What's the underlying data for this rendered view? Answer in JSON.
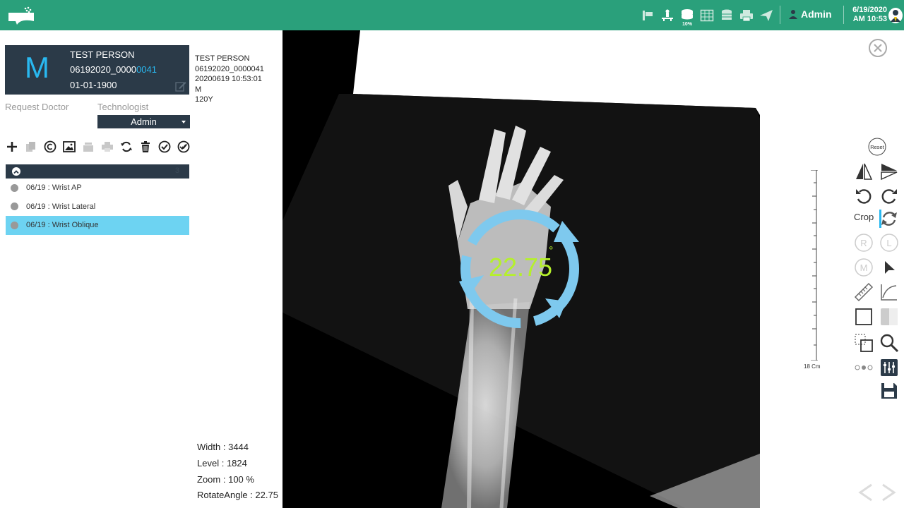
{
  "header": {
    "user": "Admin",
    "date": "6/19/2020",
    "time": "AM 10:53",
    "storage_pct": "10%"
  },
  "patient": {
    "initial": "M",
    "name": "TEST PERSON",
    "id_prefix": "06192020_0000",
    "id_suffix": "0041",
    "dob": "01-01-1900",
    "info_name": "TEST PERSON",
    "info_id": "06192020_0000041",
    "info_datetime": "20200619 10:53:01",
    "info_sex": "M",
    "info_age": "120Y"
  },
  "labels": {
    "request_doctor": "Request Doctor",
    "technologist": "Technologist"
  },
  "technologist": {
    "selected": "Admin"
  },
  "series": {
    "count": "3",
    "items": [
      {
        "label": "06/19 : Wrist AP",
        "selected": false
      },
      {
        "label": "06/19 : Wrist Lateral",
        "selected": false
      },
      {
        "label": "06/19 : Wrist Oblique",
        "selected": true
      }
    ]
  },
  "stats": {
    "width_label": "Width :",
    "width_value": "3444",
    "level_label": "Level :",
    "level_value": "1824",
    "zoom_label": "Zoom :",
    "zoom_value": "100",
    "zoom_unit": "%",
    "rotate_label": "RotateAngle :",
    "rotate_value": "22.75"
  },
  "viewer": {
    "rotate_display": "22.75",
    "degree_symbol": "°"
  },
  "right_panel": {
    "reset": "Reset",
    "crop": "Crop",
    "marker_r": "R",
    "marker_l": "L",
    "marker_m": "M",
    "ruler_label": "18 Cm"
  },
  "colors": {
    "header": "#2aa07b",
    "navy": "#2b3a48",
    "accent": "#29b8f0",
    "selected": "#6dd3f2",
    "rotate_ring": "#7ec9ee",
    "rotate_text": "#b5f02b"
  }
}
